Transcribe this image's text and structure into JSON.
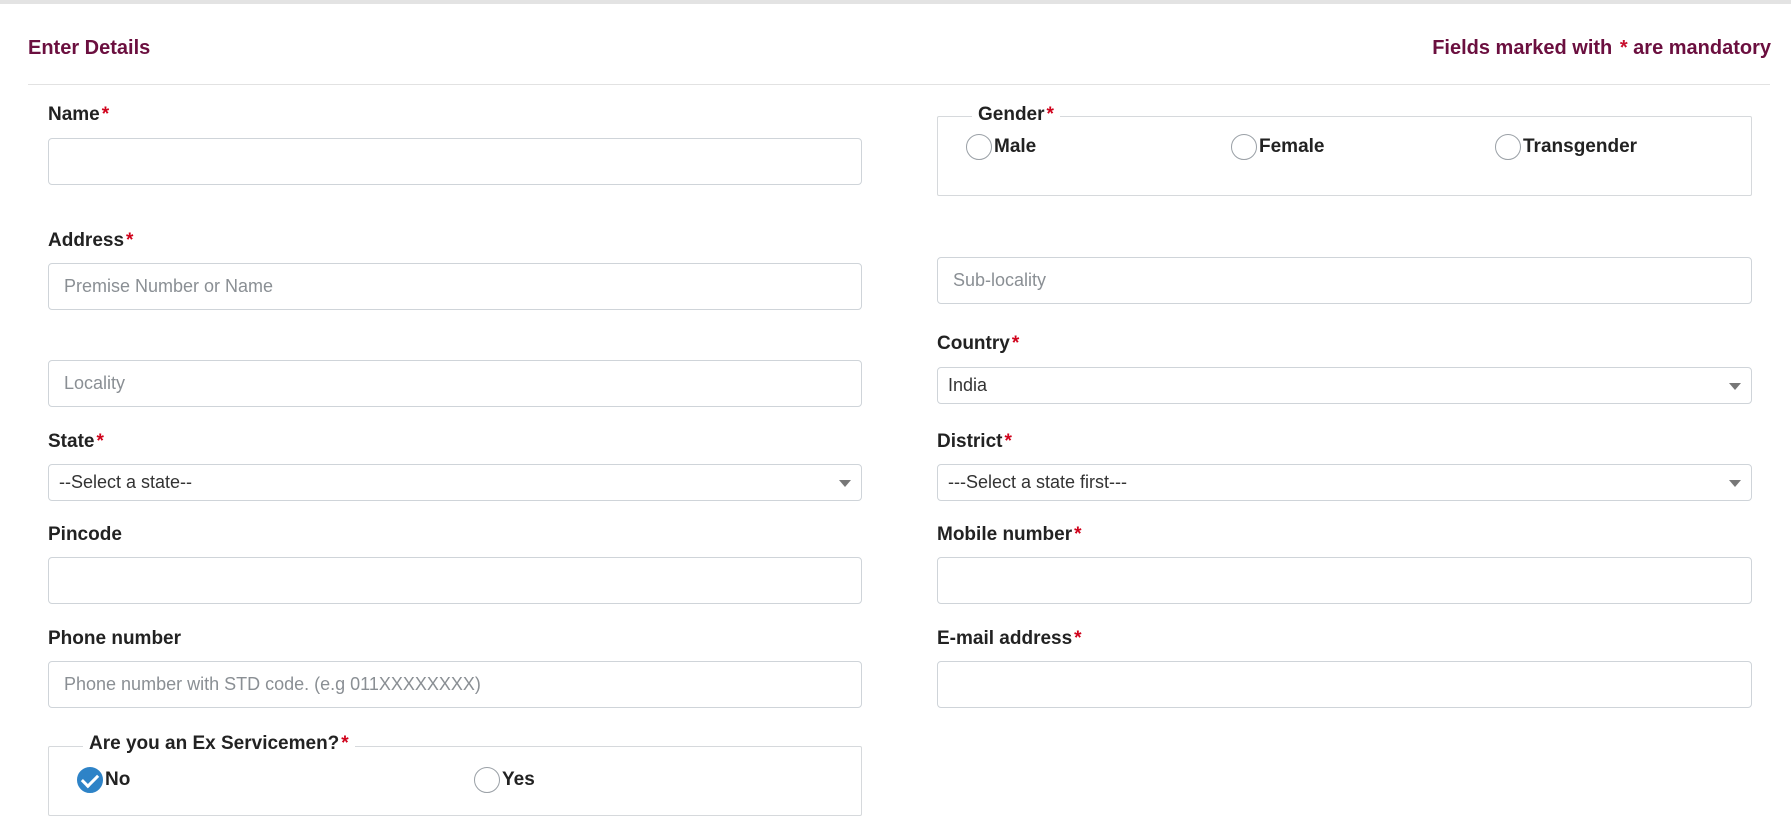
{
  "header": {
    "title": "Enter Details",
    "note_prefix": "Fields marked with ",
    "note_star": "*",
    "note_suffix": " are mandatory"
  },
  "required_mark": "*",
  "fields": {
    "name": {
      "label": "Name",
      "value": "",
      "placeholder": ""
    },
    "gender": {
      "label": "Gender",
      "options": [
        "Male",
        "Female",
        "Transgender"
      ],
      "selected": ""
    },
    "address": {
      "label": "Address",
      "premise_placeholder": "Premise Number or Name",
      "sublocality_placeholder": "Sub-locality",
      "locality_placeholder": "Locality"
    },
    "country": {
      "label": "Country",
      "value": "India"
    },
    "state": {
      "label": "State",
      "value": "--Select a state--"
    },
    "district": {
      "label": "District",
      "value": "---Select a state first---"
    },
    "pincode": {
      "label": "Pincode",
      "value": ""
    },
    "mobile": {
      "label": "Mobile number",
      "value": ""
    },
    "phone": {
      "label": "Phone number",
      "placeholder": "Phone number with STD code. (e.g 011XXXXXXXX)"
    },
    "email": {
      "label": "E-mail address",
      "value": ""
    },
    "ex_servicemen": {
      "label": "Are you an Ex Servicemen?",
      "options": [
        "No",
        "Yes"
      ],
      "selected": "No"
    }
  }
}
